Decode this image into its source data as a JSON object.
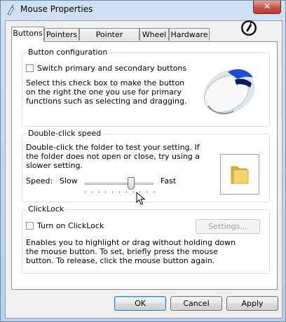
{
  "window": {
    "title": "Mouse Properties",
    "close_label": "✕"
  },
  "tabs": [
    {
      "label": "Buttons",
      "active": true
    },
    {
      "label": "Pointers",
      "active": false
    },
    {
      "label": "Pointer Options",
      "active": false
    },
    {
      "label": "Wheel",
      "active": false
    },
    {
      "label": "Hardware",
      "active": false
    }
  ],
  "button_config": {
    "legend": "Button configuration",
    "checkbox_label": "Switch primary and secondary buttons",
    "checked": false,
    "description": "Select this check box to make the button on the right the one you use for primary functions such as selecting and dragging."
  },
  "double_click": {
    "legend": "Double-click speed",
    "description": "Double-click the folder to test your setting. If the folder does not open or close, try using a slower setting.",
    "speed_label": "Speed:",
    "slow_label": "Slow",
    "fast_label": "Fast",
    "speed_level": 0.67
  },
  "clicklock": {
    "legend": "ClickLock",
    "checkbox_label": "Turn on ClickLock",
    "checked": false,
    "settings_button": "Settings...",
    "description": "Enables you to highlight or drag without holding down the mouse button. To set, briefly press the mouse button. To release, click the mouse button again."
  },
  "footer": {
    "ok": "OK",
    "cancel": "Cancel",
    "apply": "Apply"
  },
  "colors": {
    "accent": "#3c7fb1",
    "folder": "#f0c94c",
    "mouse_accent": "#1f4fd0"
  }
}
